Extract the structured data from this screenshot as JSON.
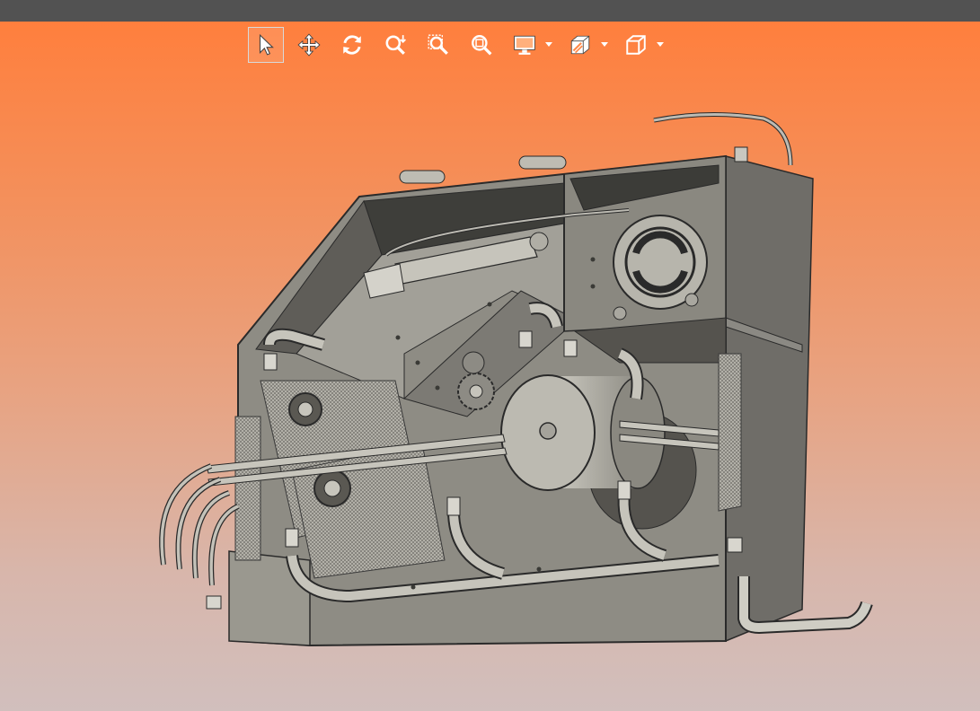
{
  "window": {
    "titlebar_color": "#525252"
  },
  "viewport": {
    "background_top": "#ff7f3d",
    "background_bottom": "#d1bfbd",
    "model_color": "#9c9a90"
  },
  "toolbar": {
    "tools": [
      {
        "name": "select",
        "icon": "arrow-cursor-icon",
        "active": true
      },
      {
        "name": "pan",
        "icon": "move-arrows-icon"
      },
      {
        "name": "rotate",
        "icon": "rotate-icon"
      },
      {
        "name": "zoom",
        "icon": "zoom-icon"
      },
      {
        "name": "zoom-window",
        "icon": "zoom-window-icon"
      },
      {
        "name": "zoom-fit",
        "icon": "zoom-fit-icon"
      },
      {
        "name": "display-mode",
        "icon": "monitor-icon",
        "dropdown": true
      },
      {
        "name": "section",
        "icon": "section-cube-icon",
        "dropdown": true
      },
      {
        "name": "view-orientation",
        "icon": "cube-icon",
        "dropdown": true
      }
    ]
  }
}
